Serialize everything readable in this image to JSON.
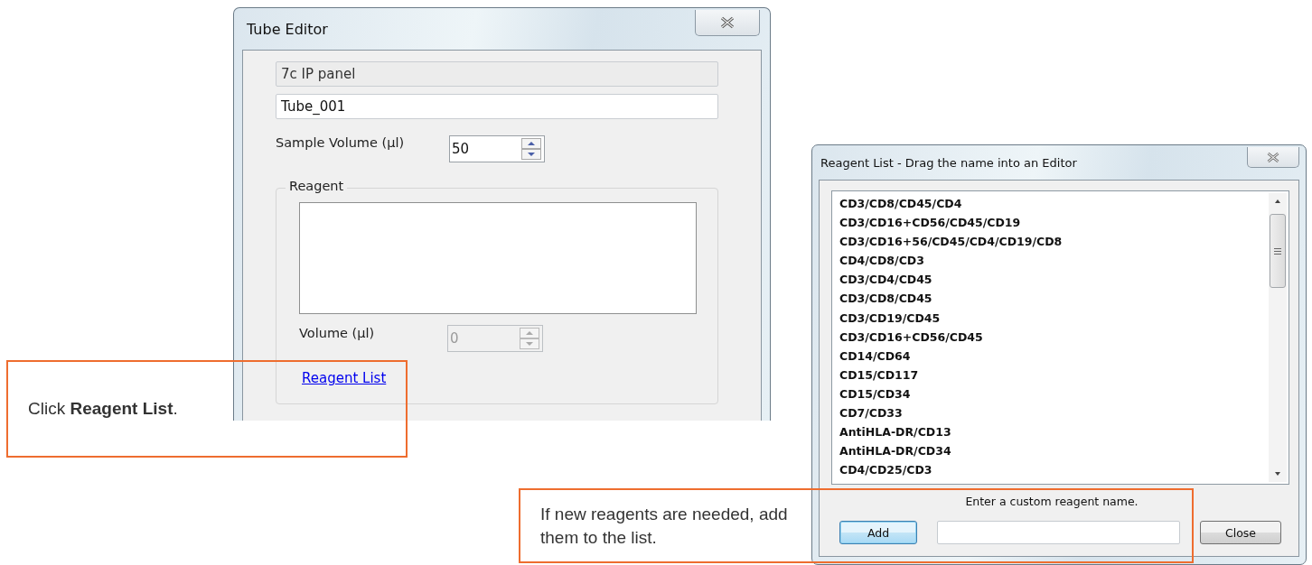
{
  "tube_editor": {
    "title": "Tube Editor",
    "panel_name": "7c IP panel",
    "tube_name": "Tube_001",
    "sample_volume": {
      "label": "Sample Volume (µl)",
      "value": "50",
      "disabled": false
    },
    "reagent_group": {
      "label": "Reagent",
      "volume": {
        "label": "Volume (µl)",
        "value": "0",
        "disabled": true
      },
      "link": "Reagent List"
    }
  },
  "reagent_list": {
    "title": "Reagent List - Drag the name into an Editor",
    "items": [
      "CD3/CD8/CD45/CD4",
      "CD3/CD16+CD56/CD45/CD19",
      "CD3/CD16+56/CD45/CD4/CD19/CD8",
      "CD4/CD8/CD3",
      "CD3/CD4/CD45",
      "CD3/CD8/CD45",
      "CD3/CD19/CD45",
      "CD3/CD16+CD56/CD45",
      "CD14/CD64",
      "CD15/CD117",
      "CD15/CD34",
      "CD7/CD33",
      "AntiHLA-DR/CD13",
      "AntiHLA-DR/CD34",
      "CD4/CD25/CD3"
    ],
    "custom_label": "Enter a custom reagent name.",
    "buttons": [
      {
        "label": "Add",
        "focused": true
      },
      {
        "label": "Close",
        "focused": false
      }
    ]
  },
  "callouts": [
    {
      "text": "Click **Reagent List**."
    },
    {
      "text": "If new reagents are needed, add them to the list."
    }
  ]
}
